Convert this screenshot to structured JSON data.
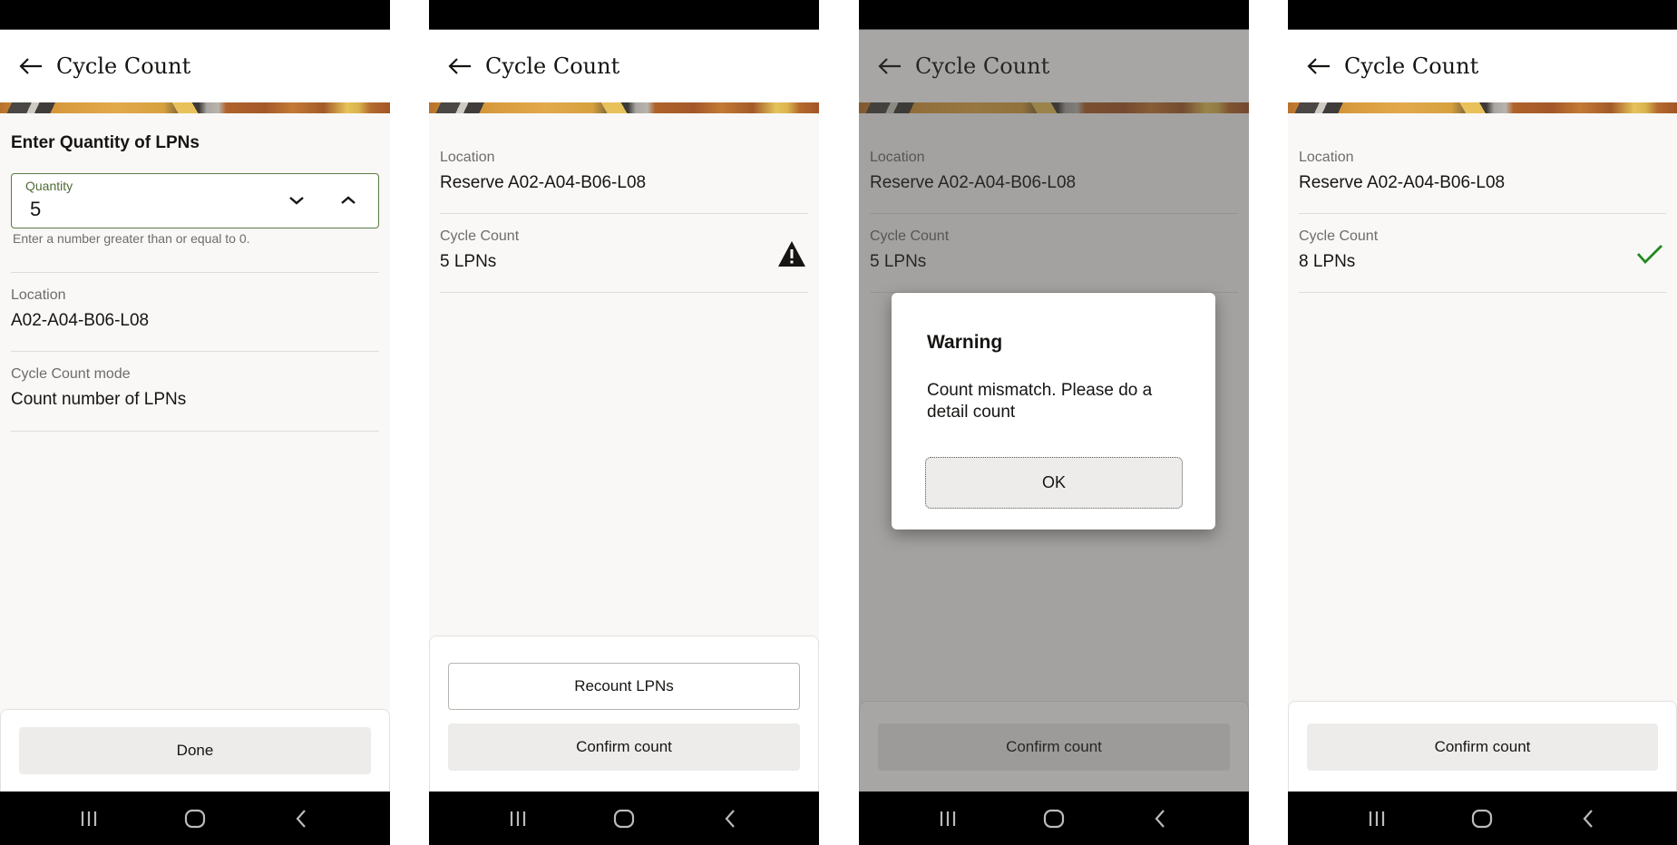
{
  "app": {
    "title": "Cycle Count"
  },
  "screens": [
    {
      "heading": "Enter Quantity of LPNs",
      "quantity_field": {
        "label": "Quantity",
        "value": "5",
        "hint": "Enter a number greater than or equal to 0."
      },
      "fields": [
        {
          "label": "Location",
          "value": "A02-A04-B06-L08"
        },
        {
          "label": "Cycle Count mode",
          "value": "Count number of LPNs"
        }
      ],
      "buttons": {
        "done": "Done"
      }
    },
    {
      "fields": [
        {
          "label": "Location",
          "value": "Reserve A02-A04-B06-L08"
        },
        {
          "label": "Cycle Count",
          "value": " 5 LPNs",
          "status_icon": "warning-icon"
        }
      ],
      "buttons": {
        "recount": "Recount LPNs",
        "confirm": "Confirm count"
      }
    },
    {
      "fields": [
        {
          "label": "Location",
          "value": "Reserve A02-A04-B06-L08"
        },
        {
          "label": "Cycle Count",
          "value": " 5 LPNs"
        }
      ],
      "buttons": {
        "confirm": "Confirm count"
      },
      "dialog": {
        "title": "Warning",
        "message": "Count mismatch. Please do a detail count",
        "ok_label": "OK"
      }
    },
    {
      "fields": [
        {
          "label": "Location",
          "value": "Reserve A02-A04-B06-L08"
        },
        {
          "label": "Cycle Count",
          "value": " 8 LPNs",
          "status_icon": "checkmark-icon"
        }
      ],
      "buttons": {
        "confirm": "Confirm count"
      }
    }
  ],
  "colors": {
    "accent_green": "#4f6b36",
    "success_check": "#1e8a1e",
    "warning_icon": "#161513"
  },
  "navbar": {
    "icons": [
      "recent-apps-icon",
      "home-icon",
      "back-nav-icon"
    ]
  }
}
